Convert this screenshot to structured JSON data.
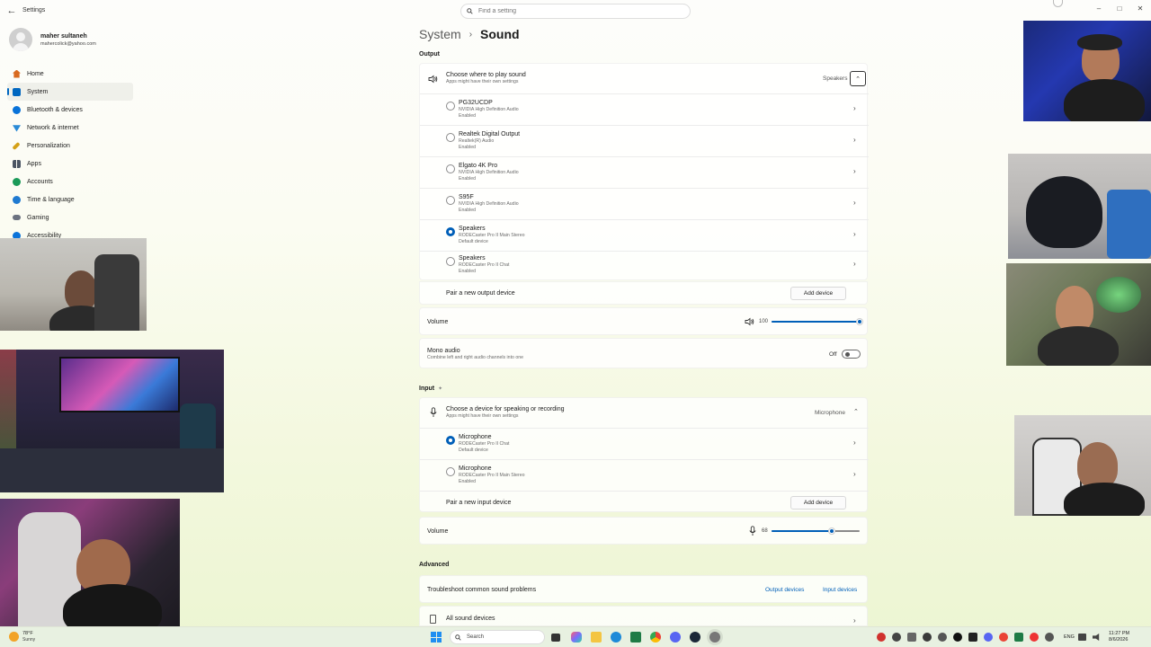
{
  "titlebar": {
    "app_title": "Settings",
    "search_placeholder": "Find a setting"
  },
  "user": {
    "name": "maher sultaneh",
    "email": "mahercolick@yahoo.com"
  },
  "sidebar": {
    "items": [
      {
        "label": "Home",
        "icon": "home-icon",
        "color": "#d86a1f"
      },
      {
        "label": "System",
        "icon": "system-icon",
        "color": "#0067c0"
      },
      {
        "label": "Bluetooth & devices",
        "icon": "bluetooth-icon",
        "color": "#0a73d9"
      },
      {
        "label": "Network & internet",
        "icon": "wifi-icon",
        "color": "#2a8ad6"
      },
      {
        "label": "Personalization",
        "icon": "brush-icon",
        "color": "#d4a017"
      },
      {
        "label": "Apps",
        "icon": "apps-icon",
        "color": "#4b5563"
      },
      {
        "label": "Accounts",
        "icon": "accounts-icon",
        "color": "#1b9a59"
      },
      {
        "label": "Time & language",
        "icon": "globe-icon",
        "color": "#1f7ad1"
      },
      {
        "label": "Gaming",
        "icon": "gaming-icon",
        "color": "#6b7280"
      },
      {
        "label": "Accessibility",
        "icon": "accessibility-icon",
        "color": "#0a73d9"
      }
    ]
  },
  "breadcrumb": {
    "parent": "System",
    "separator": "›",
    "current": "Sound"
  },
  "output": {
    "section_label": "Output",
    "header_title": "Choose where to play sound",
    "header_subtitle": "Apps might have their own settings",
    "selected_value": "Speakers",
    "devices": [
      {
        "name": "PG32UCDP",
        "driver": "NVIDIA High Definition Audio",
        "status": "Enabled",
        "selected": false
      },
      {
        "name": "Realtek Digital Output",
        "driver": "Realtek(R) Audio",
        "status": "Enabled",
        "selected": false
      },
      {
        "name": "Elgato 4K Pro",
        "driver": "NVIDIA High Definition Audio",
        "status": "Enabled",
        "selected": false
      },
      {
        "name": "S95F",
        "driver": "NVIDIA High Definition Audio",
        "status": "Enabled",
        "selected": false
      },
      {
        "name": "Speakers",
        "driver": "RODECaster Pro II Main Stereo",
        "status": "Default device",
        "selected": true
      },
      {
        "name": "Speakers",
        "driver": "RODECaster Pro II Chat",
        "status": "Enabled",
        "selected": false
      }
    ],
    "pair_label": "Pair a new output device",
    "add_button": "Add device",
    "volume_label": "Volume",
    "volume_value": "100",
    "volume_fraction": 1.0,
    "mono_title": "Mono audio",
    "mono_subtitle": "Combine left and right audio channels into one",
    "mono_state": "Off"
  },
  "input": {
    "section_label": "Input",
    "header_title": "Choose a device for speaking or recording",
    "header_subtitle": "Apps might have their own settings",
    "selected_value": "Microphone",
    "devices": [
      {
        "name": "Microphone",
        "driver": "RODECaster Pro II Chat",
        "status": "Default device",
        "selected": true
      },
      {
        "name": "Microphone",
        "driver": "RODECaster Pro II Main Stereo",
        "status": "Enabled",
        "selected": false
      }
    ],
    "pair_label": "Pair a new input device",
    "add_button": "Add device",
    "volume_label": "Volume",
    "volume_value": "68",
    "volume_fraction": 0.68
  },
  "advanced": {
    "section_label": "Advanced",
    "troubleshoot_label": "Troubleshoot common sound problems",
    "output_link": "Output devices",
    "input_link": "Input devices",
    "all_devices_label": "All sound devices"
  },
  "taskbar": {
    "weather_temp": "78°F",
    "weather_desc": "Sunny",
    "search_placeholder": "Search",
    "lang": "ENG",
    "time": "11:27 PM",
    "date": "8/6/2026"
  }
}
